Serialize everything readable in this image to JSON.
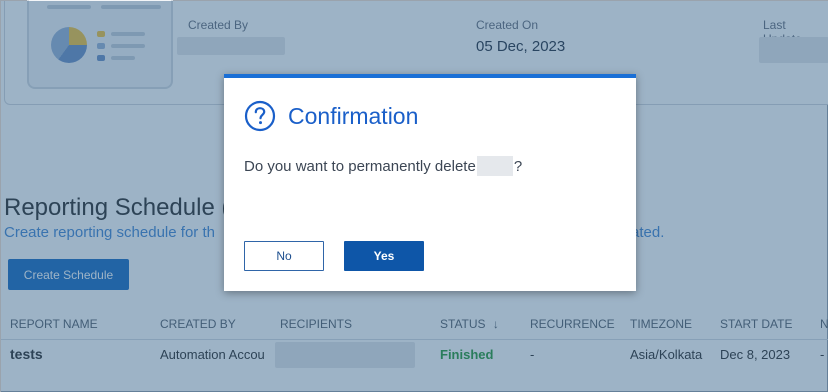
{
  "summary": {
    "created_by_label": "Created By",
    "created_on_label": "Created On",
    "created_on_value": "05 Dec, 2023",
    "last_updated_label": "Last Update"
  },
  "schedule_section": {
    "title": "Reporting Schedule (",
    "description": "Create reporting schedule for th",
    "description_tail": "ated.",
    "create_button_label": "Create Schedule"
  },
  "table": {
    "columns": [
      "REPORT NAME",
      "CREATED BY",
      "RECIPIENTS",
      "STATUS",
      "RECURRENCE",
      "TIMEZONE",
      "START DATE",
      "N"
    ],
    "status_sort_icon": "arrow-down-icon",
    "rows": [
      {
        "report_name": "tests",
        "created_by": "Automation Accou",
        "status": "Finished",
        "recurrence": "-",
        "timezone": "Asia/Kolkata",
        "start_date": "Dec 8, 2023",
        "next": "-"
      }
    ]
  },
  "dialog": {
    "icon": "question-circle-icon",
    "title": "Confirmation",
    "message_prefix": "Do you want to permanently delete",
    "message_suffix": "?",
    "no_label": "No",
    "yes_label": "Yes"
  },
  "colors": {
    "accent": "#1a6fd6",
    "overlay": "#265680",
    "status_finished": "#2e9d3f",
    "primary_button": "#0e56a8"
  }
}
